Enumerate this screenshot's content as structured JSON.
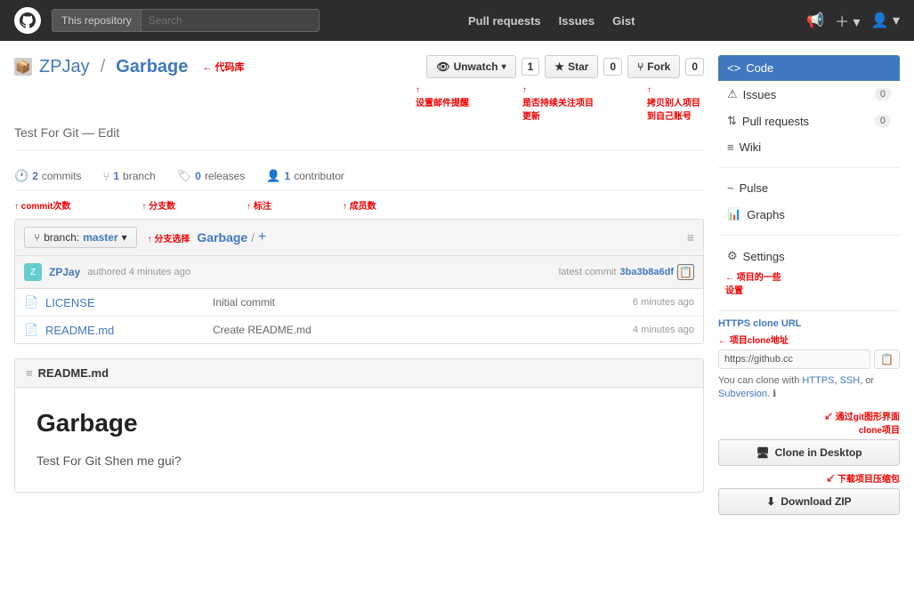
{
  "topnav": {
    "repo_label": "This repository",
    "search_placeholder": "Search",
    "links": [
      "Pull requests",
      "Issues",
      "Gist"
    ],
    "logo_symbol": "🐙"
  },
  "repo": {
    "owner": "ZPJay",
    "name": "Garbage",
    "description": "Test For Git — Edit",
    "annotation_label": "代码库",
    "commits_count": "2",
    "commits_label": "commits",
    "branch_count": "1",
    "branch_label": "branch",
    "releases_count": "0",
    "releases_label": "releases",
    "contributors_count": "1",
    "contributors_label": "contributor",
    "annotation_commits": "commit次数",
    "annotation_branches": "分支数",
    "annotation_tags": "标注",
    "annotation_members": "成员数"
  },
  "actions": {
    "unwatch_label": "Unwatch",
    "unwatch_count": "1",
    "star_label": "Star",
    "star_count": "0",
    "fork_label": "Fork",
    "fork_count": "0"
  },
  "branch_toolbar": {
    "branch_btn_label": "branch:",
    "branch_name": "master",
    "path_root": "Garbage",
    "path_add": "+",
    "annotation_branch": "分支选择"
  },
  "commit_info": {
    "create_message": "Create README.md",
    "author": "ZPJay",
    "time_ago": "authored 4 minutes ago",
    "latest_label": "latest commit",
    "hash": "3ba3b8a6df"
  },
  "files": [
    {
      "icon": "📄",
      "name": "LICENSE",
      "message": "Initial commit",
      "time": "6 minutes ago"
    },
    {
      "icon": "📄",
      "name": "README.md",
      "message": "Create README.md",
      "time": "4 minutes ago"
    }
  ],
  "readme": {
    "header": "README.md",
    "title": "Garbage",
    "body": "Test For Git Shen me gui?"
  },
  "sidebar": {
    "nav_items": [
      {
        "icon": "<>",
        "label": "Code",
        "badge": null,
        "active": true
      },
      {
        "icon": "⚠",
        "label": "Issues",
        "badge": "0",
        "active": false
      },
      {
        "icon": "⇅",
        "label": "Pull requests",
        "badge": "0",
        "active": false
      },
      {
        "icon": "≡",
        "label": "Wiki",
        "badge": null,
        "active": false
      },
      {
        "icon": "~",
        "label": "Pulse",
        "badge": null,
        "active": false
      },
      {
        "icon": "📊",
        "label": "Graphs",
        "badge": null,
        "active": false
      },
      {
        "icon": "⚙",
        "label": "Settings",
        "badge": null,
        "active": false
      }
    ],
    "clone_label": "HTTPS clone URL",
    "clone_url": "https://github.cc",
    "clone_note": "You can clone with HTTPS, SSH, or Subversion.",
    "clone_desktop_label": "Clone in Desktop",
    "download_zip_label": "Download ZIP",
    "annotation_clone": "项目clone地址",
    "annotation_desktop": "通过git图形界面\nclone项目",
    "annotation_zip": "下载项目压缩包",
    "annotation_settings": "项目的一些\n设置"
  }
}
